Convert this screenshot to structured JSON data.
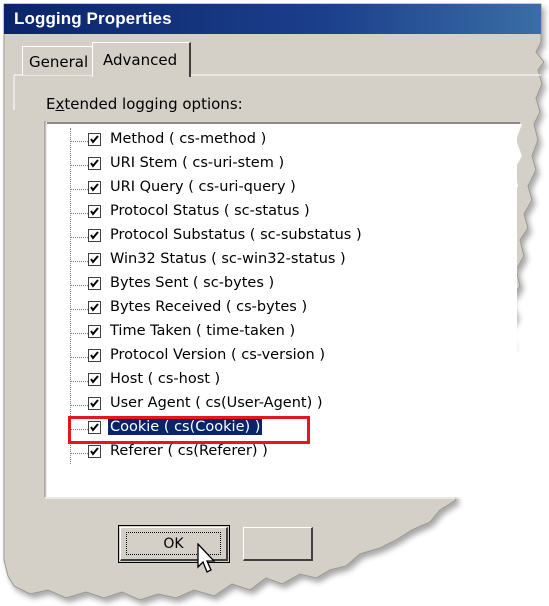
{
  "window": {
    "title": "Logging Properties"
  },
  "tabs": [
    {
      "label": "General",
      "active": false
    },
    {
      "label": "Advanced",
      "active": true
    }
  ],
  "group": {
    "label_prefix": "E",
    "label_underlined": "x",
    "label_rest": "tended logging options:"
  },
  "tree_items": [
    {
      "label": "Method  ( cs-method )",
      "checked": true
    },
    {
      "label": "URI Stem  ( cs-uri-stem )",
      "checked": true
    },
    {
      "label": "URI Query  ( cs-uri-query )",
      "checked": true
    },
    {
      "label": "Protocol Status  ( sc-status )",
      "checked": true
    },
    {
      "label": "Protocol Substatus ( sc-substatus )",
      "checked": true
    },
    {
      "label": "Win32 Status  ( sc-win32-status )",
      "checked": true
    },
    {
      "label": "Bytes Sent  ( sc-bytes )",
      "checked": true
    },
    {
      "label": "Bytes Received  ( cs-bytes )",
      "checked": true
    },
    {
      "label": "Time Taken  ( time-taken )",
      "checked": true
    },
    {
      "label": "Protocol Version  ( cs-version )",
      "checked": true
    },
    {
      "label": "Host  ( cs-host )",
      "checked": true
    },
    {
      "label": "User Agent  ( cs(User-Agent) )",
      "checked": true
    },
    {
      "label": "Cookie  ( cs(Cookie) )",
      "checked": true,
      "selected": true
    },
    {
      "label": "Referer  ( cs(Referer) )",
      "checked": true
    }
  ],
  "buttons": {
    "ok_label": "OK"
  },
  "colors": {
    "highlight_border": "#e8141e",
    "selection": "#0a246a",
    "dialog_bg": "#d4d0c8"
  }
}
